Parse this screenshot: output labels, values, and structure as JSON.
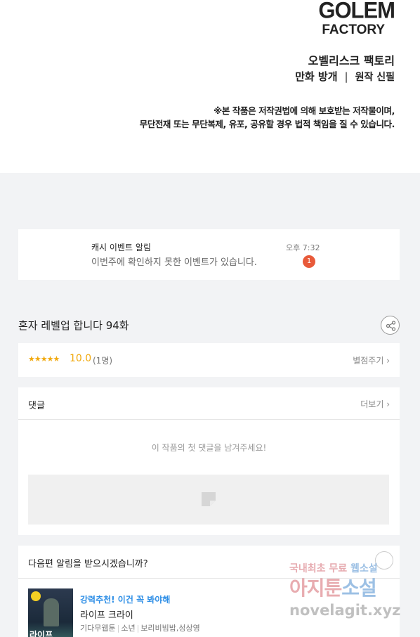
{
  "credits": {
    "logo_line1": "GOLEM",
    "logo_line2": "FACTORY",
    "studio": "오벨리스크 팩토리",
    "role1": "만화 방개",
    "separator": "|",
    "role2": "원작 신필",
    "notice_line1": "※본 작품은 저작권법에 의해 보호받는 저작물이며,",
    "notice_line2": "무단전재 또는 무단복제, 유포, 공유할 경우 법적 책임을 질 수 있습니다."
  },
  "event": {
    "title": "캐시 이벤트 알림",
    "message": "이번주에 확인하지 못한 이벤트가 있습니다.",
    "time": "오후 7:32",
    "badge_count": "1"
  },
  "episode": {
    "title": "혼자 레벨업 합니다 94화",
    "share_icon": "share-icon"
  },
  "rating": {
    "stars": "★★★★★",
    "score": "10.0",
    "count": "(1명)",
    "rate_link": "별점주기 ›",
    "star_color": "#f1a90e"
  },
  "comments": {
    "title": "댓글",
    "more": "더보기 ›",
    "empty_message": "이 작품의 첫 댓글을 남겨주세요!"
  },
  "next_notice": {
    "title": "다음편 알림을 받으시겠습니까?",
    "recommend_tag": "강력추천! 이건 꼭 봐야해",
    "recommend_title": "라이프 크라이",
    "thumb_text": "라이프",
    "meta_platform": "기다무웹툰",
    "meta_genre": "소년",
    "meta_authors": "보리비빔밥,성상영",
    "tag_color": "#2d8ee6"
  },
  "watermark": {
    "line1_a": "국내최초 무료 ",
    "line1_b": "웹소설",
    "line2_a": "아지툰",
    "line2_b": "소설",
    "line3": "novelagit.xyz"
  }
}
